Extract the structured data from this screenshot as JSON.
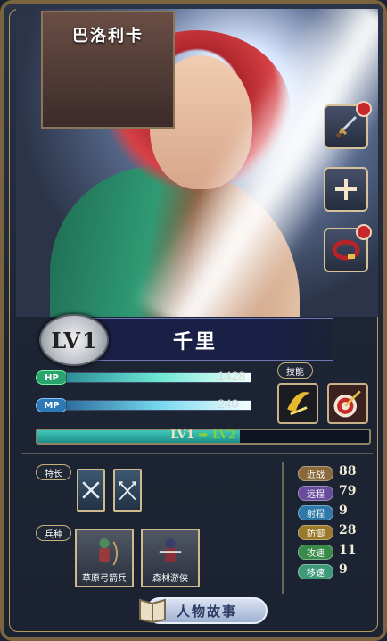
{
  "character": {
    "title_tag": "巴洛利卡",
    "name": "千里",
    "level_prefix": "LV",
    "level": "1"
  },
  "vitals": {
    "hp_label": "HP",
    "hp_value": "1428",
    "hp_fill_pct": 100,
    "mp_label": "MP",
    "mp_value": "240",
    "mp_fill_pct": 100
  },
  "skills": {
    "label": "技能",
    "items": [
      {
        "icon": "golden-slash-icon"
      },
      {
        "icon": "arrow-target-icon"
      }
    ]
  },
  "experience": {
    "from": "LV1",
    "to": "LV2",
    "fill_pct": 61
  },
  "traits": {
    "label": "特长",
    "items": [
      {
        "icon": "crossed-blades-icon"
      },
      {
        "icon": "crossed-arrows-icon"
      }
    ]
  },
  "unit_types": {
    "label": "兵种",
    "items": [
      {
        "name": "草原弓箭兵"
      },
      {
        "name": "森林游侠"
      }
    ]
  },
  "stats": [
    {
      "label": "近战",
      "value": "88",
      "color": "#8a6a3a"
    },
    {
      "label": "远程",
      "value": "79",
      "color": "#6a4c9c"
    },
    {
      "label": "射程",
      "value": "9",
      "color": "#2f79a8"
    },
    {
      "label": "防御",
      "value": "28",
      "color": "#9a7a2a"
    },
    {
      "label": "攻速",
      "value": "11",
      "color": "#3a8a4a"
    },
    {
      "label": "移速",
      "value": "9",
      "color": "#3f9a7a"
    }
  ],
  "side_buttons": [
    {
      "icon": "dagger-icon"
    },
    {
      "icon": "plus-icon"
    },
    {
      "icon": "belt-icon"
    }
  ],
  "story_button": {
    "label": "人物故事"
  }
}
